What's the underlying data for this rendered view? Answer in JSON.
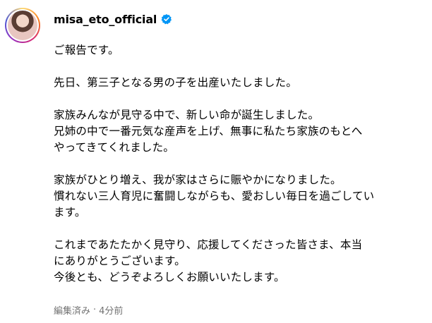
{
  "post": {
    "username": "misa_eto_official",
    "verified": true,
    "accent_color": "#0095f6",
    "caption": {
      "p1": "ご報告です。",
      "p2": "先日、第三子となる男の子を出産いたしました。",
      "p3_l1": "家族みんなが見守る中で、新しい命が誕生しました。",
      "p3_l2": "兄姉の中で一番元気な産声を上げ、無事に私たち家族のもとへ",
      "p3_l3": "やってきてくれました。",
      "p4_l1": "家族がひとり増え、我が家はさらに賑やかになりました。",
      "p4_l2": "慣れない三人育児に奮闘しながらも、愛おしい毎日を過ごしてい",
      "p4_l3": "ます。",
      "p5_l1": "これまであたたかく見守り、応援してくださった皆さま、本当",
      "p5_l2": "にありがとうございます。",
      "p5_l3": "今後とも、どうぞよろしくお願いいたします。"
    },
    "meta": {
      "edited": "編集済み",
      "separator": "·",
      "time_ago": "4分前"
    }
  }
}
